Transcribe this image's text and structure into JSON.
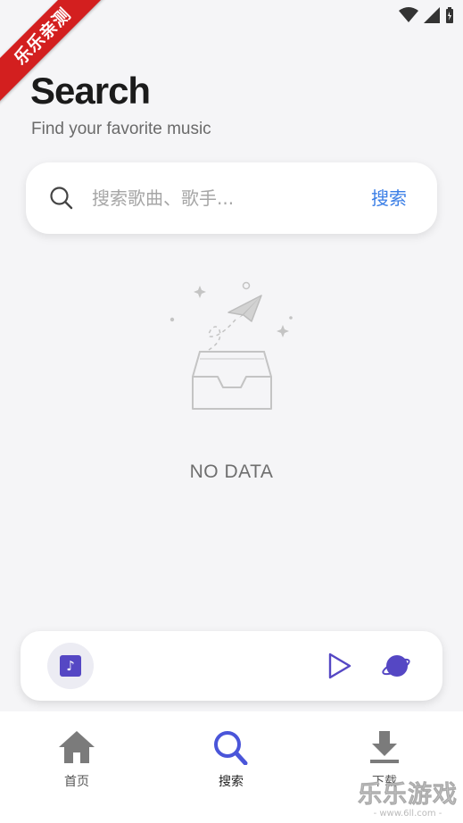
{
  "status_bar": {
    "icons": [
      "wifi-icon",
      "signal-icon",
      "battery-icon"
    ]
  },
  "ribbon": {
    "text": "乐乐亲测"
  },
  "header": {
    "title": "Search",
    "subtitle": "Find your favorite music"
  },
  "search": {
    "placeholder": "搜索歌曲、歌手...",
    "value": "",
    "submit_label": "搜索",
    "accent_color": "#3a7ee6"
  },
  "empty_state": {
    "text": "NO DATA",
    "icon": "empty-inbox-paper-plane-icon"
  },
  "player": {
    "album_icon": "music-note-icon",
    "album_glyph": "♪",
    "play_icon": "play-icon",
    "playlist_icon": "planet-icon",
    "accent_color": "#5547c4"
  },
  "bottom_nav": {
    "items": [
      {
        "label": "首页",
        "icon": "home-icon",
        "active": false
      },
      {
        "label": "搜索",
        "icon": "search-icon",
        "active": true
      },
      {
        "label": "下载",
        "icon": "download-icon",
        "active": false
      }
    ]
  },
  "watermark": {
    "main": "乐乐游戏",
    "sub": "- www.6ll.com -"
  }
}
